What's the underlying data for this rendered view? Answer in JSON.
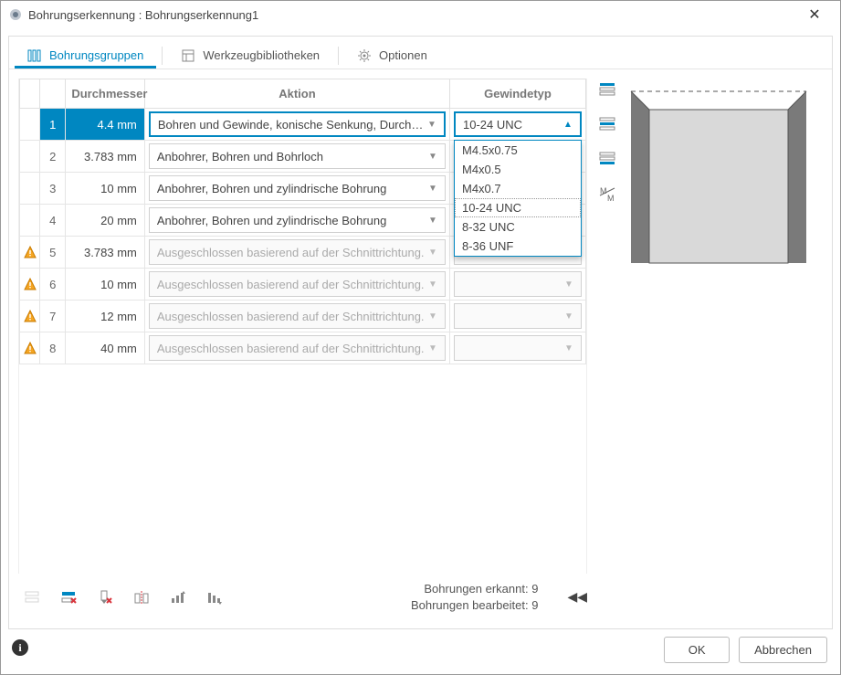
{
  "window": {
    "title": "Bohrungserkennung : Bohrungserkennung1"
  },
  "tabs": {
    "groups": "Bohrungsgruppen",
    "tools": "Werkzeugbibliotheken",
    "options": "Optionen"
  },
  "columns": {
    "diameter": "Durchmesser",
    "action": "Aktion",
    "thread": "Gewindetyp"
  },
  "rows": [
    {
      "n": "1",
      "warn": false,
      "diameter": "4.4 mm",
      "action": "Bohren und Gewinde, konische Senkung, Durchgangsbohrung",
      "thread": "10-24 UNC",
      "disabled": false,
      "selected": true,
      "threadOpen": true
    },
    {
      "n": "2",
      "warn": false,
      "diameter": "3.783 mm",
      "action": "Anbohrer, Bohren und Bohrloch",
      "thread": "",
      "disabled": false,
      "selected": false,
      "threadOpen": false
    },
    {
      "n": "3",
      "warn": false,
      "diameter": "10 mm",
      "action": "Anbohrer, Bohren und zylindrische Bohrung",
      "thread": "",
      "disabled": false,
      "selected": false,
      "threadOpen": false
    },
    {
      "n": "4",
      "warn": false,
      "diameter": "20 mm",
      "action": "Anbohrer, Bohren und zylindrische Bohrung",
      "thread": "",
      "disabled": false,
      "selected": false,
      "threadOpen": false
    },
    {
      "n": "5",
      "warn": true,
      "diameter": "3.783 mm",
      "action": "Ausgeschlossen basierend auf der Schnittrichtung.",
      "thread": "",
      "disabled": true,
      "selected": false,
      "threadOpen": false
    },
    {
      "n": "6",
      "warn": true,
      "diameter": "10 mm",
      "action": "Ausgeschlossen basierend auf der Schnittrichtung.",
      "thread": "",
      "disabled": true,
      "selected": false,
      "threadOpen": false
    },
    {
      "n": "7",
      "warn": true,
      "diameter": "12 mm",
      "action": "Ausgeschlossen basierend auf der Schnittrichtung.",
      "thread": "",
      "disabled": true,
      "selected": false,
      "threadOpen": false
    },
    {
      "n": "8",
      "warn": true,
      "diameter": "40 mm",
      "action": "Ausgeschlossen basierend auf der Schnittrichtung.",
      "thread": "",
      "disabled": true,
      "selected": false,
      "threadOpen": false
    }
  ],
  "threadOptions": [
    "M4.5x0.75",
    "M4x0.5",
    "M4x0.7",
    "10-24 UNC",
    "8-32 UNC",
    "8-36 UNF"
  ],
  "threadHighlight": "10-24 UNC",
  "stats": {
    "recognizedLabel": "Bohrungen erkannt:",
    "recognizedValue": "9",
    "editedLabel": "Bohrungen bearbeitet:",
    "editedValue": "9"
  },
  "buttons": {
    "ok": "OK",
    "cancel": "Abbrechen"
  }
}
